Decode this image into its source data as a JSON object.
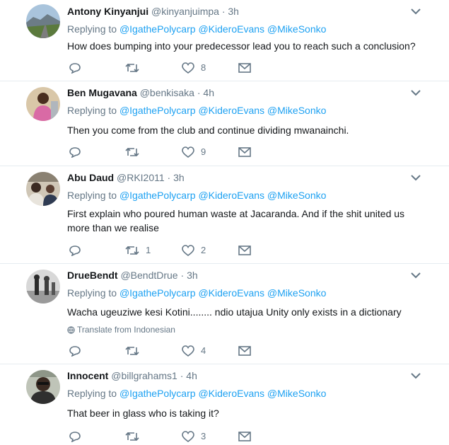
{
  "colors": {
    "link": "#1da1f2",
    "muted": "#657786",
    "text": "#14171a",
    "border": "#e6ecf0"
  },
  "tweets": [
    {
      "name": "Antony Kinyanjui",
      "handle": "@kinyanjuimpa",
      "time": "3h",
      "replying_label": "Replying to",
      "mentions": [
        "@IgathePolycarp",
        "@KideroEvans",
        "@MikeSonko"
      ],
      "text": "How does bumping into your predecessor lead you to reach such a conclusion?",
      "retweets": "",
      "likes": "8",
      "avatar_icon": "landscape-avatar"
    },
    {
      "name": "Ben Mugavana",
      "handle": "@benkisaka",
      "time": "4h",
      "replying_label": "Replying to",
      "mentions": [
        "@IgathePolycarp",
        "@KideroEvans",
        "@MikeSonko"
      ],
      "text": "Then you come from the club and continue dividing mwanainchi.",
      "retweets": "",
      "likes": "9",
      "avatar_icon": "person-avatar"
    },
    {
      "name": "Abu Daud",
      "handle": "@RKI2011",
      "time": "3h",
      "replying_label": "Replying to",
      "mentions": [
        "@IgathePolycarp",
        "@KideroEvans",
        "@MikeSonko"
      ],
      "text": "First explain who poured human waste at Jacaranda. And if the shit united us more than we realise",
      "retweets": "1",
      "likes": "2",
      "avatar_icon": "people-avatar"
    },
    {
      "name": "DrueBendt",
      "handle": "@BendtDrue",
      "time": "3h",
      "replying_label": "Replying to",
      "mentions": [
        "@IgathePolycarp",
        "@KideroEvans",
        "@MikeSonko"
      ],
      "text": "Wacha ugeuziwe kesi Kotini........ ndio utajua Unity only exists in a  dictionary",
      "translate": "Translate from Indonesian",
      "retweets": "",
      "likes": "4",
      "avatar_icon": "street-avatar"
    },
    {
      "name": "Innocent",
      "handle": "@billgrahams1",
      "time": "4h",
      "replying_label": "Replying to",
      "mentions": [
        "@IgathePolycarp",
        "@KideroEvans",
        "@MikeSonko"
      ],
      "text": "That beer in glass who is taking it?",
      "retweets": "",
      "likes": "3",
      "avatar_icon": "selfie-avatar"
    }
  ]
}
